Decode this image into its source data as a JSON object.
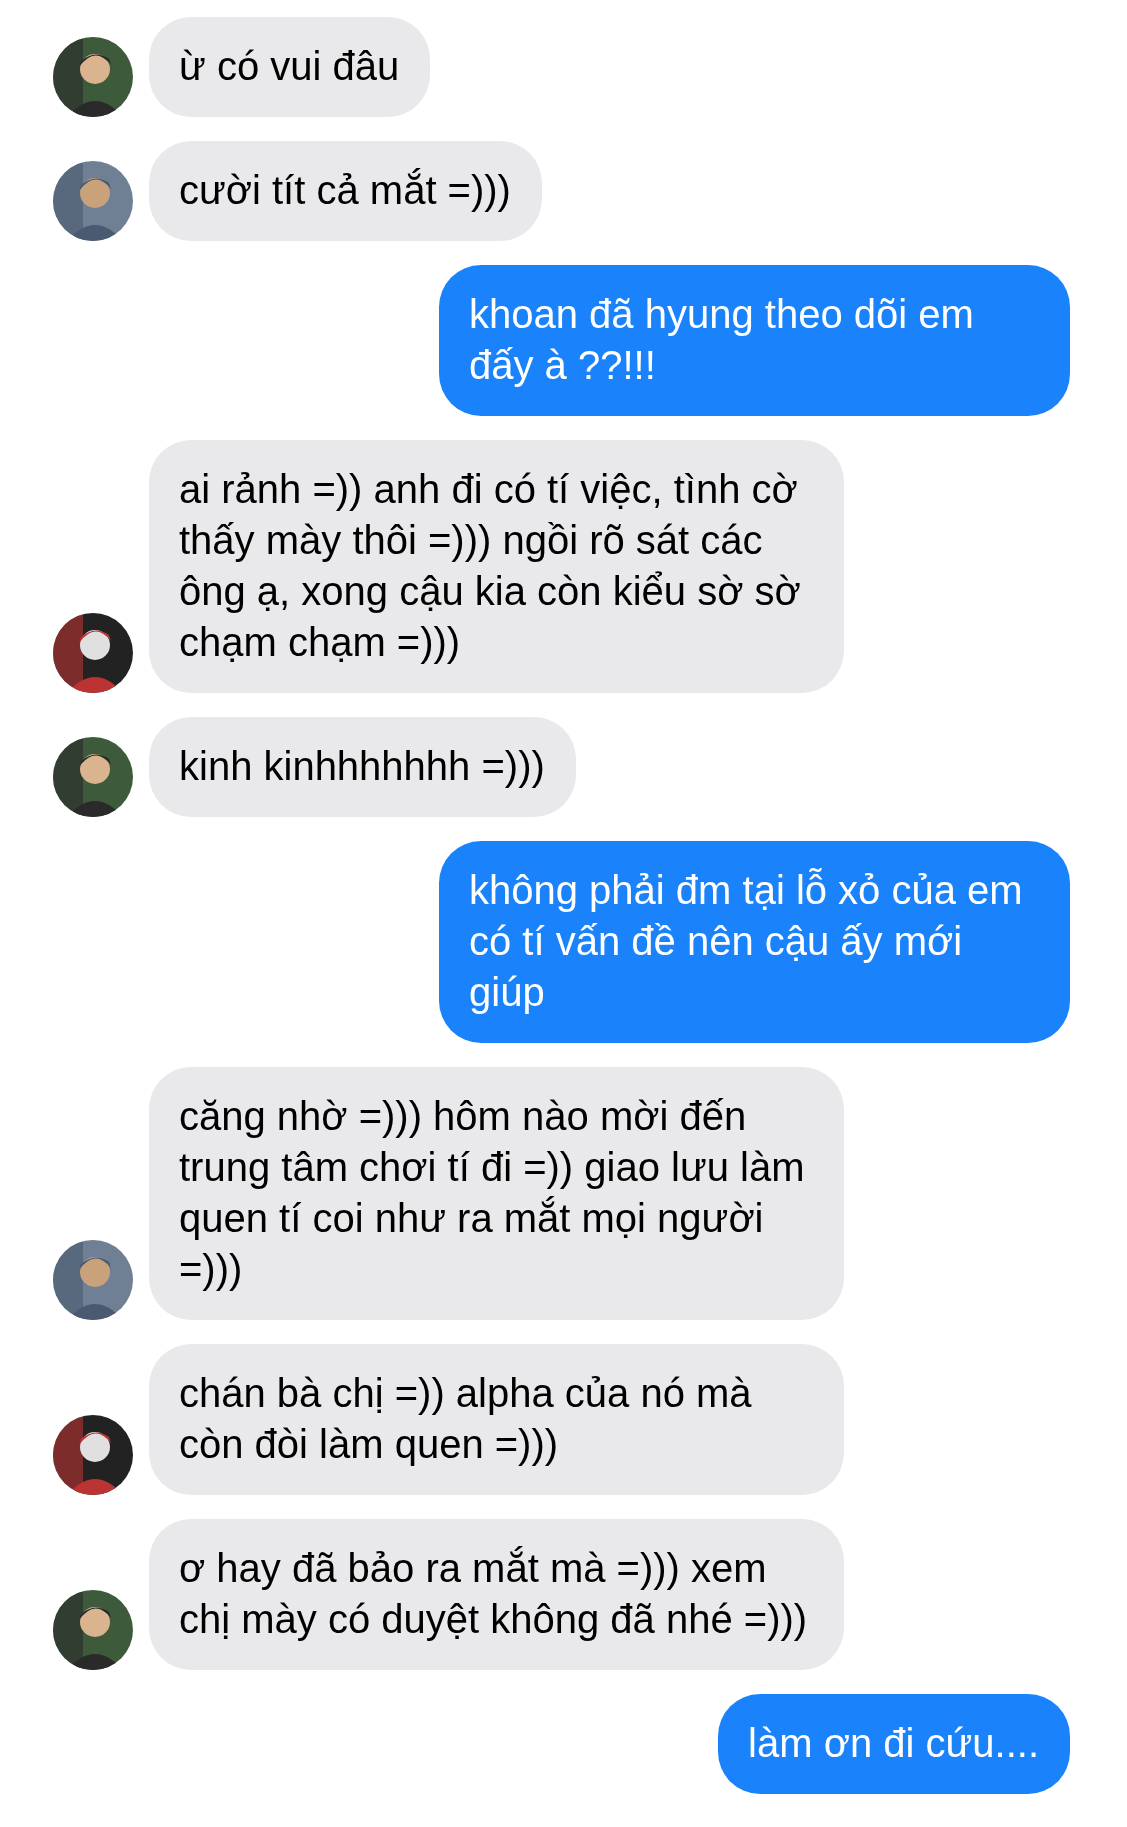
{
  "messages": [
    {
      "kind": "incoming",
      "text": "ừ có vui đâu"
    },
    {
      "kind": "incoming",
      "text": "cười tít cả mắt =)))"
    },
    {
      "kind": "outgoing",
      "text": "khoan đã hyung theo dõi em đấy à ??!!!"
    },
    {
      "kind": "incoming",
      "text": "ai rảnh =)) anh đi có tí việc, tình cờ thấy mày thôi =))) ngồi rõ sát các ông ạ, xong cậu kia còn kiểu sờ sờ chạm chạm =)))"
    },
    {
      "kind": "incoming",
      "text": "kinh kinhhhhhhh =)))"
    },
    {
      "kind": "outgoing",
      "text": "không phải đm tại lỗ xỏ của em có tí vấn đề nên cậu ấy mới giúp"
    },
    {
      "kind": "incoming",
      "text": "căng nhờ =))) hôm nào mời đến trung tâm chơi tí đi =)) giao lưu làm quen tí coi như ra mắt mọi người =)))"
    },
    {
      "kind": "incoming",
      "text": "chán bà chị =)) alpha của nó mà còn đòi làm quen =)))"
    },
    {
      "kind": "incoming",
      "text": "ơ hay đã bảo ra mắt mà =))) xem chị mày có duyệt không đã nhé =)))"
    },
    {
      "kind": "outgoing",
      "text": "làm ơn đi cứu...."
    }
  ]
}
